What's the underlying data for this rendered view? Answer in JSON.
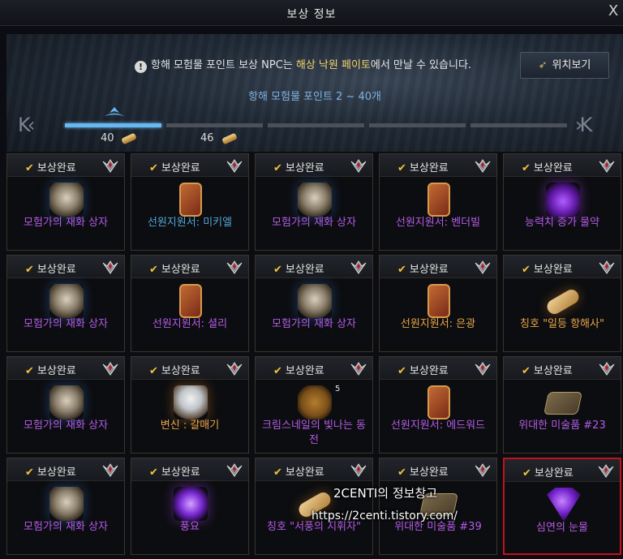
{
  "window": {
    "title": "보상 정보",
    "close_label": "X"
  },
  "header": {
    "notice_prefix": "항해 모험물 포인트 보상 NPC는",
    "notice_highlight": "해상 낙원 페이토",
    "notice_suffix": "에서 만날 수 있습니다.",
    "location_button": "위치보기",
    "range_text": "항해 모험물 포인트 2 ~ 40개"
  },
  "progress": {
    "nav_left": "K‹",
    "nav_right": "›K",
    "segments_total": 5,
    "segments_filled": 1,
    "milestones": [
      {
        "value": "40"
      },
      {
        "value": "46"
      }
    ]
  },
  "colors": {
    "purple": "#b45be6",
    "blue": "#53a6d8",
    "orange": "#e8a44a",
    "check": "#f0c43a",
    "progress": "#67b7f0"
  },
  "reward_status_label": "보상완료",
  "rewards": [
    {
      "name": "모험가의 재화 상자",
      "grade": "purple",
      "icon": "chest-icon"
    },
    {
      "name": "선원지원서: 미키엘",
      "grade": "blue",
      "icon": "crew-contract-icon"
    },
    {
      "name": "모험가의 재화 상자",
      "grade": "purple",
      "icon": "chest-icon"
    },
    {
      "name": "선원지원서: 벤더빌",
      "grade": "purple",
      "icon": "crew-contract-icon"
    },
    {
      "name": "능력치 증가 물약",
      "grade": "purple",
      "icon": "potion-icon"
    },
    {
      "name": "모험가의 재화 상자",
      "grade": "purple",
      "icon": "chest-icon"
    },
    {
      "name": "선원지원서: 셜리",
      "grade": "purple",
      "icon": "crew-contract-icon"
    },
    {
      "name": "모험가의 재화 상자",
      "grade": "purple",
      "icon": "chest-icon"
    },
    {
      "name": "선원지원서: 은광",
      "grade": "orange",
      "icon": "crew-contract-icon"
    },
    {
      "name": "칭호 \"일등 항해사\"",
      "grade": "orange",
      "icon": "title-scroll-icon"
    },
    {
      "name": "모험가의 재화 상자",
      "grade": "purple",
      "icon": "chest-icon"
    },
    {
      "name": "변신 : 갈매기",
      "grade": "orange",
      "icon": "seagull-icon"
    },
    {
      "name": "크림스네일의 빛나는 동전",
      "grade": "purple",
      "icon": "coin-icon",
      "stack": "5"
    },
    {
      "name": "선원지원서: 에드워드",
      "grade": "purple",
      "icon": "crew-contract-icon"
    },
    {
      "name": "위대한 미술품 #23",
      "grade": "purple",
      "icon": "artwork-icon"
    },
    {
      "name": "모험가의 재화 상자",
      "grade": "purple",
      "icon": "chest-icon"
    },
    {
      "name": "풍요",
      "grade": "purple",
      "icon": "orb-icon"
    },
    {
      "name": "칭호 \"서풍의 지휘자\"",
      "grade": "purple",
      "icon": "title-scroll-icon"
    },
    {
      "name": "위대한 미술품 #39",
      "grade": "purple",
      "icon": "artwork-icon"
    },
    {
      "name": "심연의 눈물",
      "grade": "purple",
      "icon": "gem-icon",
      "selected": true
    }
  ],
  "watermark": {
    "line1": "2CENTI의 정보창고",
    "line2": "https://2centi.tistory.com/"
  }
}
